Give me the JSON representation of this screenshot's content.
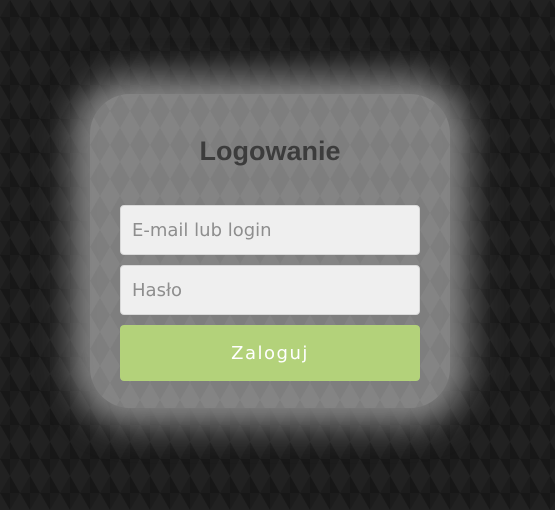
{
  "login": {
    "title": "Logowanie",
    "email_placeholder": "E-mail lub login",
    "password_placeholder": "Hasło",
    "submit_label": "Zaloguj"
  },
  "colors": {
    "background": "#1c1c1c",
    "card": "#7d7d7d",
    "title": "#3c3c3c",
    "input_background": "#efefef",
    "button": "#b3d27a",
    "button_text": "#ffffff"
  }
}
